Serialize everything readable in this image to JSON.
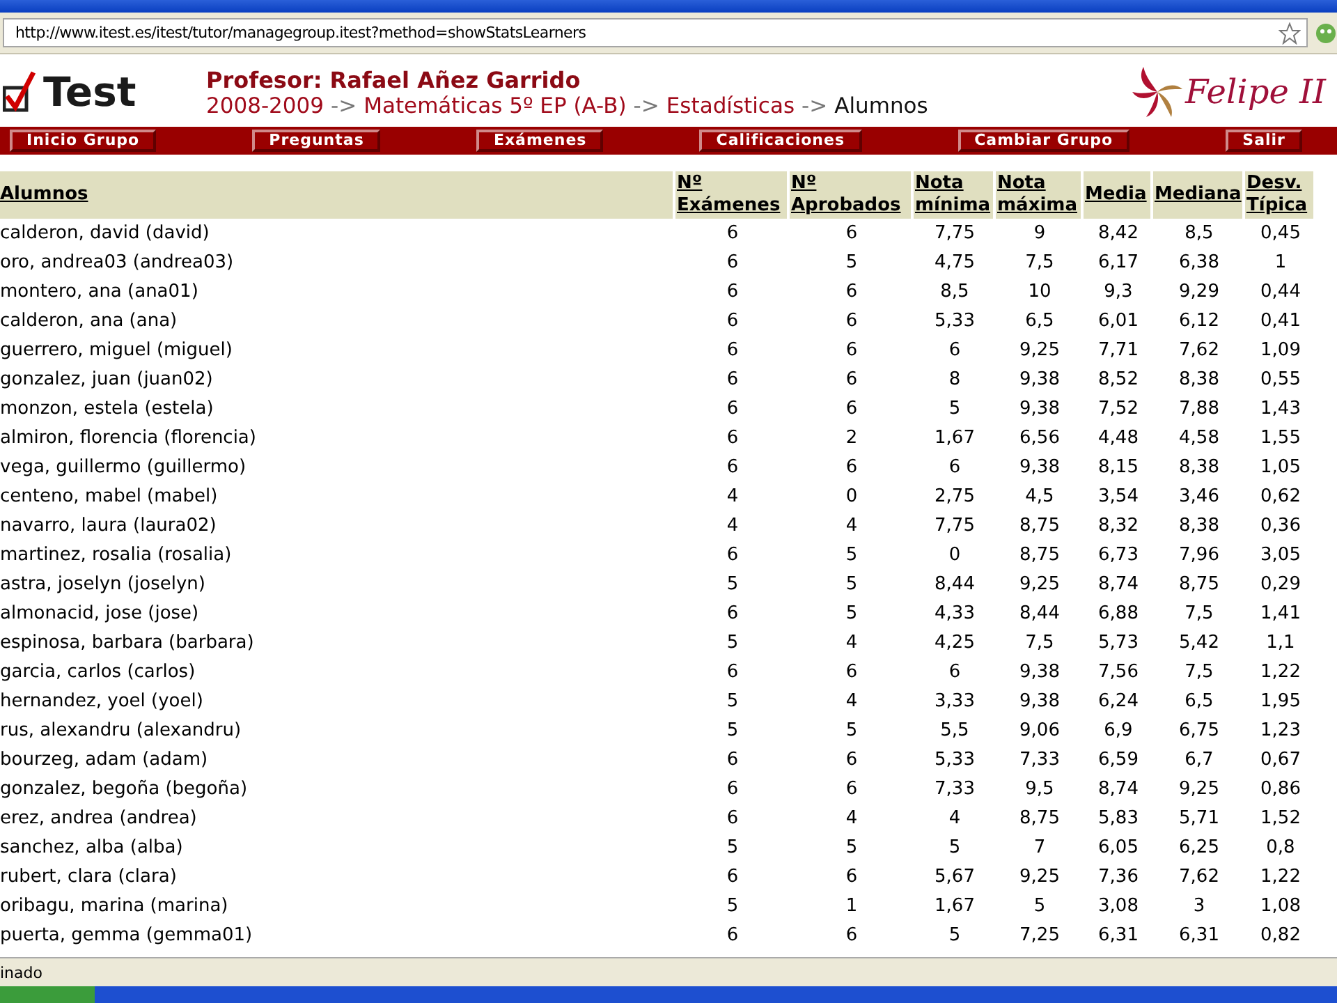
{
  "browser": {
    "address": "http://www.itest.es/itest/tutor/managegroup.itest?method=showStatsLearners"
  },
  "header": {
    "logo_text": "Test",
    "professor": "Profesor: Rafael Añez Garrido",
    "breadcrumb": [
      {
        "kind": "link",
        "label": "2008-2009"
      },
      {
        "kind": "separator",
        "label": "->"
      },
      {
        "kind": "link",
        "label": "Matemáticas 5º EP (A-B)"
      },
      {
        "kind": "separator",
        "label": "->"
      },
      {
        "kind": "link",
        "label": "Estadísticas"
      },
      {
        "kind": "separator",
        "label": "->"
      },
      {
        "kind": "current",
        "label": "Alumnos"
      }
    ],
    "school_logo": "Felipe II"
  },
  "nav": [
    "Inicio Grupo",
    "Preguntas",
    "Exámenes",
    "Calificaciones",
    "Cambiar Grupo",
    "Salir"
  ],
  "table": {
    "columns": [
      "Alumnos",
      "Nº\nExámenes",
      "Nº\nAprobados",
      "Nota\nmínima",
      "Nota\nmáxima",
      "Media",
      "Mediana",
      "Desv.\nTípica"
    ],
    "rows": [
      [
        "calderon, david (david)",
        "6",
        "6",
        "7,75",
        "9",
        "8,42",
        "8,5",
        "0,45"
      ],
      [
        "oro, andrea03 (andrea03)",
        "6",
        "5",
        "4,75",
        "7,5",
        "6,17",
        "6,38",
        "1"
      ],
      [
        "montero, ana (ana01)",
        "6",
        "6",
        "8,5",
        "10",
        "9,3",
        "9,29",
        "0,44"
      ],
      [
        "calderon, ana (ana)",
        "6",
        "6",
        "5,33",
        "6,5",
        "6,01",
        "6,12",
        "0,41"
      ],
      [
        "guerrero, miguel (miguel)",
        "6",
        "6",
        "6",
        "9,25",
        "7,71",
        "7,62",
        "1,09"
      ],
      [
        "gonzalez, juan (juan02)",
        "6",
        "6",
        "8",
        "9,38",
        "8,52",
        "8,38",
        "0,55"
      ],
      [
        "monzon, estela (estela)",
        "6",
        "6",
        "5",
        "9,38",
        "7,52",
        "7,88",
        "1,43"
      ],
      [
        "almiron, florencia (florencia)",
        "6",
        "2",
        "1,67",
        "6,56",
        "4,48",
        "4,58",
        "1,55"
      ],
      [
        "vega, guillermo (guillermo)",
        "6",
        "6",
        "6",
        "9,38",
        "8,15",
        "8,38",
        "1,05"
      ],
      [
        "centeno, mabel (mabel)",
        "4",
        "0",
        "2,75",
        "4,5",
        "3,54",
        "3,46",
        "0,62"
      ],
      [
        "navarro, laura (laura02)",
        "4",
        "4",
        "7,75",
        "8,75",
        "8,32",
        "8,38",
        "0,36"
      ],
      [
        "martinez, rosalia (rosalia)",
        "6",
        "5",
        "0",
        "8,75",
        "6,73",
        "7,96",
        "3,05"
      ],
      [
        "astra, joselyn (joselyn)",
        "5",
        "5",
        "8,44",
        "9,25",
        "8,74",
        "8,75",
        "0,29"
      ],
      [
        "almonacid, jose (jose)",
        "6",
        "5",
        "4,33",
        "8,44",
        "6,88",
        "7,5",
        "1,41"
      ],
      [
        "espinosa, barbara (barbara)",
        "5",
        "4",
        "4,25",
        "7,5",
        "5,73",
        "5,42",
        "1,1"
      ],
      [
        "garcia, carlos (carlos)",
        "6",
        "6",
        "6",
        "9,38",
        "7,56",
        "7,5",
        "1,22"
      ],
      [
        "hernandez, yoel (yoel)",
        "5",
        "4",
        "3,33",
        "9,38",
        "6,24",
        "6,5",
        "1,95"
      ],
      [
        "rus, alexandru (alexandru)",
        "5",
        "5",
        "5,5",
        "9,06",
        "6,9",
        "6,75",
        "1,23"
      ],
      [
        "bourzeg, adam (adam)",
        "6",
        "6",
        "5,33",
        "7,33",
        "6,59",
        "6,7",
        "0,67"
      ],
      [
        "gonzalez, begoña (begoña)",
        "6",
        "6",
        "7,33",
        "9,5",
        "8,74",
        "9,25",
        "0,86"
      ],
      [
        "erez, andrea (andrea)",
        "6",
        "4",
        "4",
        "8,75",
        "5,83",
        "5,71",
        "1,52"
      ],
      [
        "sanchez, alba (alba)",
        "5",
        "5",
        "5",
        "7",
        "6,05",
        "6,25",
        "0,8"
      ],
      [
        "rubert, clara (clara)",
        "6",
        "6",
        "5,67",
        "9,25",
        "7,36",
        "7,62",
        "1,22"
      ],
      [
        "oribagu, marina (marina)",
        "5",
        "1",
        "1,67",
        "5",
        "3,08",
        "3",
        "1,08"
      ],
      [
        "puerta, gemma (gemma01)",
        "6",
        "6",
        "5",
        "7,25",
        "6,31",
        "6,31",
        "0,82"
      ]
    ]
  },
  "status_bar": "inado"
}
